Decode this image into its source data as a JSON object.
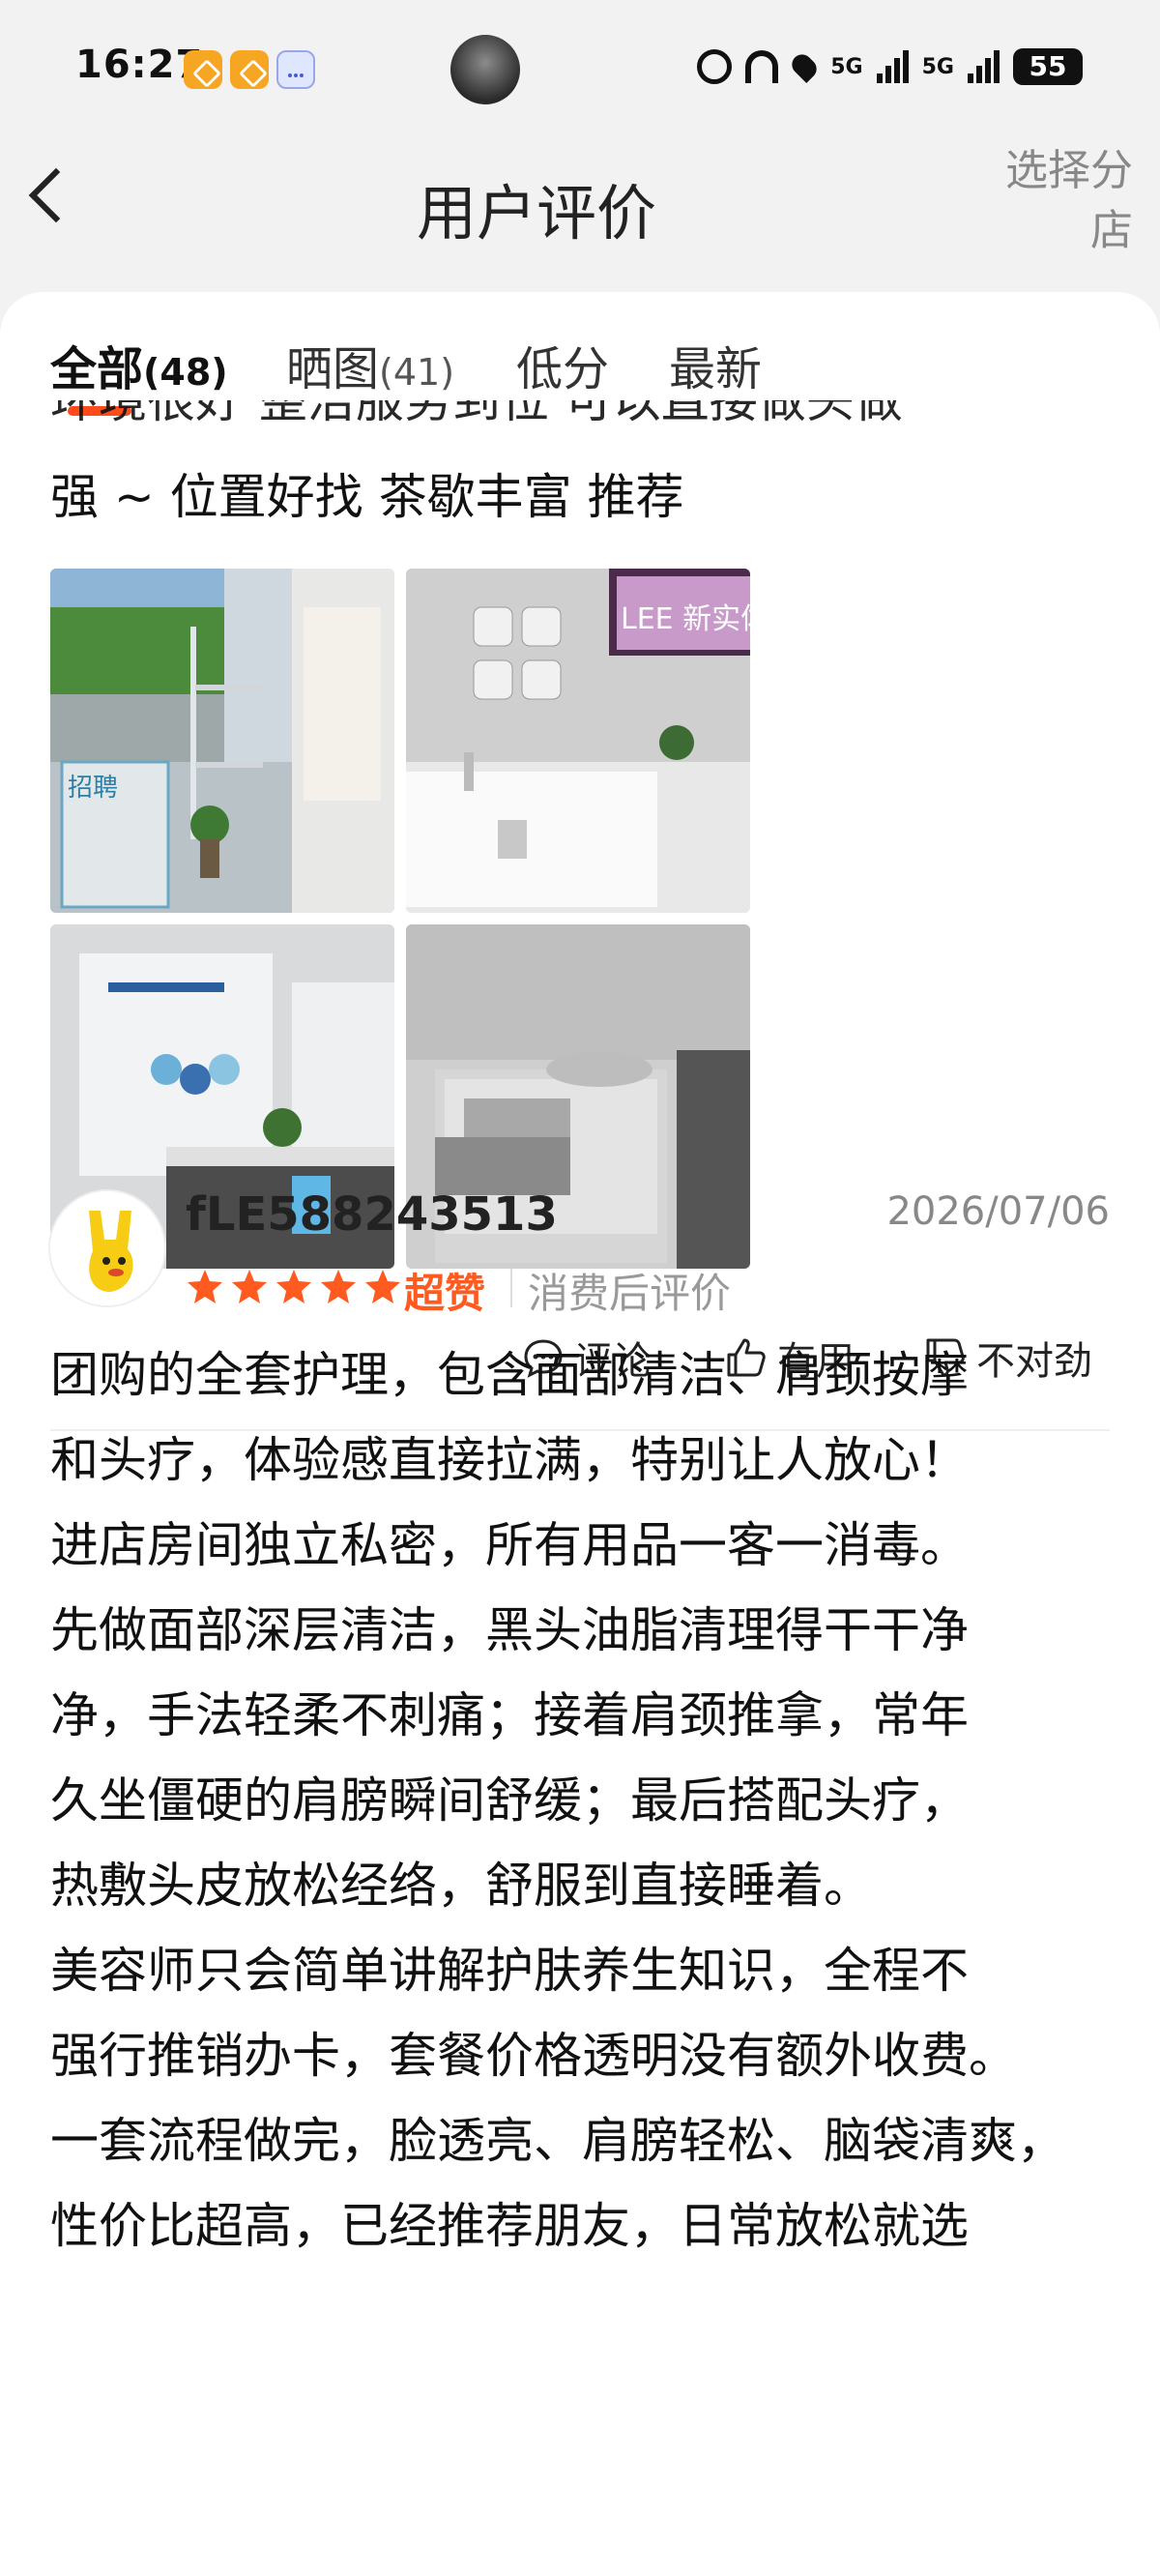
{
  "status": {
    "time": "16:27",
    "network1": "5G",
    "network2": "5G",
    "battery": "55"
  },
  "nav": {
    "title": "用户评价",
    "right_line1": "选择分",
    "right_line2": "店"
  },
  "tabs": [
    {
      "label": "全部",
      "count": "(48)"
    },
    {
      "label": "晒图",
      "count": "(41)"
    },
    {
      "label": "低分",
      "count": ""
    },
    {
      "label": "最新",
      "count": ""
    }
  ],
  "prev_review": {
    "cut_line": "环境很好 整洁服务到位 可以直接做头做",
    "last_line": "强 ~ 位置好找 茶歇丰富 推荐"
  },
  "photo_text": {
    "tv": "LEE 新实体",
    "poster": "招聘"
  },
  "actions": {
    "comment": "评论",
    "useful": "有用",
    "wrong": "不对劲"
  },
  "review": {
    "username": "fLE588243513",
    "date": "2026/07/06",
    "stars": 5,
    "rating_word": "超赞",
    "rating_type": "消费后评价",
    "lines": [
      "团购的全套护理，包含面部清洁、肩颈按摩",
      "和头疗，体验感直接拉满，特别让人放心！",
      "进店房间独立私密，所有用品一客一消毒。",
      "先做面部深层清洁，黑头油脂清理得干干净",
      "净，手法轻柔不刺痛；接着肩颈推拿，常年",
      "久坐僵硬的肩膀瞬间舒缓；最后搭配头疗，",
      "热敷头皮放松经络，舒服到直接睡着。",
      "美容师只会简单讲解护肤养生知识，全程不",
      "强行推销办卡，套餐价格透明没有额外收费。",
      "一套流程做完，脸透亮、肩膀轻松、脑袋清爽，",
      "性价比超高，已经推荐朋友，日常放松就选"
    ]
  },
  "colors": {
    "accent": "#ff4a1a",
    "star": "#ff5a1f",
    "muted": "#888888"
  }
}
